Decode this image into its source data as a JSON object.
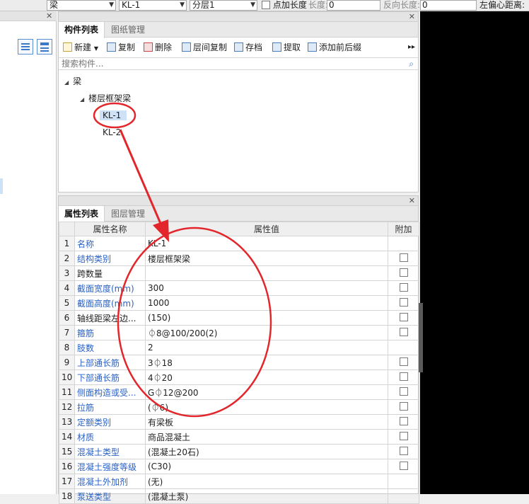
{
  "toolbar": {
    "combo1": "梁",
    "combo2": "KL-1",
    "combo3": "分层1",
    "point_length_label": "点加长度",
    "length_label": "长度:",
    "length_value": "0",
    "reverse_length_label": "反向长度:",
    "reverse_length_value": "0",
    "offset_label": "左偏心距离:"
  },
  "component_panel": {
    "tabs": [
      "构件列表",
      "图纸管理"
    ],
    "actions": {
      "new": "新建",
      "copy": "复制",
      "delete": "删除",
      "layer_copy": "层间复制",
      "archive": "存档",
      "extract": "提取",
      "add_prefix": "添加前后缀"
    },
    "search_placeholder": "搜索构件...",
    "tree": {
      "root": "梁",
      "group": "楼层框架梁",
      "items": [
        "KL-1",
        "KL-2"
      ]
    }
  },
  "property_panel": {
    "tabs": [
      "属性列表",
      "图层管理"
    ],
    "headers": [
      "属性名称",
      "属性值",
      "附加"
    ],
    "rows": [
      {
        "no": "1",
        "name": "名称",
        "value": "KL-1",
        "checkbox": false
      },
      {
        "no": "2",
        "name": "结构类别",
        "value": "楼层框架梁",
        "checkbox": true
      },
      {
        "no": "3",
        "name": "跨数量",
        "value": "",
        "checkbox": true
      },
      {
        "no": "4",
        "name": "截面宽度(mm)",
        "value": "300",
        "checkbox": true
      },
      {
        "no": "5",
        "name": "截面高度(mm)",
        "value": "1000",
        "checkbox": true
      },
      {
        "no": "6",
        "name": "轴线距梁左边...",
        "value": "(150)",
        "checkbox": true
      },
      {
        "no": "7",
        "name": "箍筋",
        "value": "⏀8@100/200(2)",
        "checkbox": true
      },
      {
        "no": "8",
        "name": "肢数",
        "value": "2",
        "checkbox": false
      },
      {
        "no": "9",
        "name": "上部通长筋",
        "value": "3⏀18",
        "checkbox": true
      },
      {
        "no": "10",
        "name": "下部通长筋",
        "value": "4⏀20",
        "checkbox": true
      },
      {
        "no": "11",
        "name": "侧面构造或受...",
        "value": "G⏀12@200",
        "checkbox": true
      },
      {
        "no": "12",
        "name": "拉筋",
        "value": "(⏀6)",
        "checkbox": true
      },
      {
        "no": "13",
        "name": "定额类别",
        "value": "有梁板",
        "checkbox": true
      },
      {
        "no": "14",
        "name": "材质",
        "value": "商品混凝土",
        "checkbox": true
      },
      {
        "no": "15",
        "name": "混凝土类型",
        "value": "(混凝土20石)",
        "checkbox": true
      },
      {
        "no": "16",
        "name": "混凝土强度等级",
        "value": "(C30)",
        "checkbox": true
      },
      {
        "no": "17",
        "name": "混凝土外加剂",
        "value": "(无)",
        "checkbox": false
      },
      {
        "no": "18",
        "name": "泵送类型",
        "value": "(混凝土泵)",
        "checkbox": false
      }
    ]
  },
  "colors": {
    "annotation_red": "#e2262b",
    "selection_blue": "#cde1f7",
    "link_blue": "#2a62c5"
  }
}
